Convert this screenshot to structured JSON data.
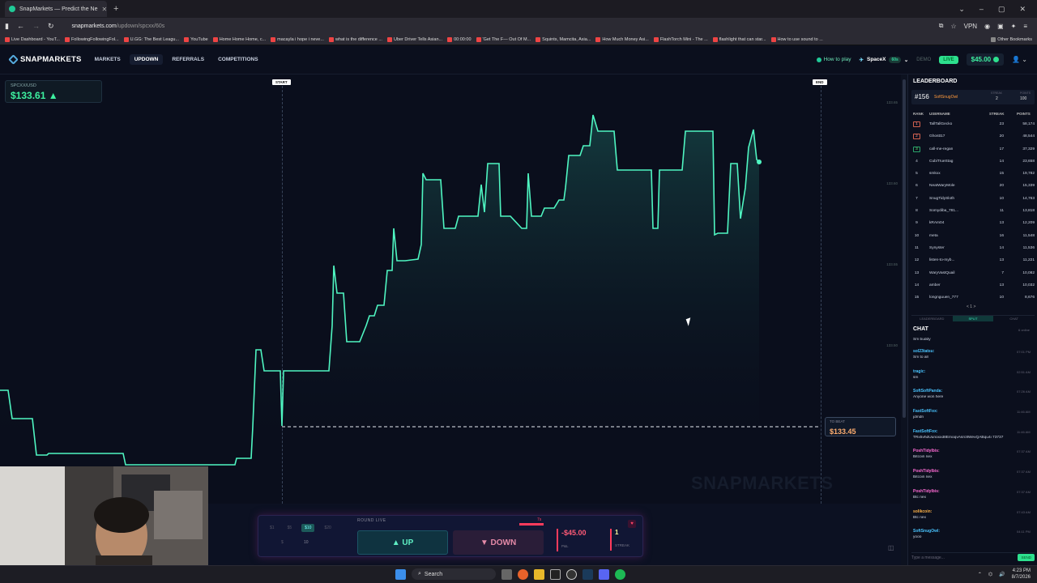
{
  "browser": {
    "tab_title": "SnapMarkets — Predict the Ne",
    "url_host": "snapmarkets.com",
    "url_path": "/updown/spcxx/60s",
    "vpn": "VPN",
    "window_controls": [
      "–",
      "▢",
      "✕"
    ],
    "new_tab": "+"
  },
  "bookmarks": [
    "Live Dashboard - YouT...",
    "FollowingFollowingFol...",
    "U.GG: The Best Leagu...",
    "YouTube",
    "Home Home Home, c...",
    "macayla i hope i neve...",
    "what is the difference ...",
    "Uber Driver Tells Asian...",
    "00:00:00",
    "'Get The F— Out Of M...",
    "Squints, Mamcita, Asia...",
    "How Much Money Asi...",
    "FlashTorch Mini - The ...",
    "flashlight that can star...",
    "How to use sound to ...",
    "Other Bookmarks"
  ],
  "header": {
    "logo": "SNAPMARKETS",
    "nav": [
      "MARKETS",
      "UPDOWN",
      "REFERRALS",
      "COMPETITIONS"
    ],
    "how_to_play": "How to play",
    "market": "SpaceX",
    "market_pill": "60s",
    "demo": "DEMO",
    "live": "LIVE",
    "balance": "$45.00"
  },
  "chart": {
    "pair": "SPCXX/USD",
    "price": "$133.61 ▲",
    "start_label": "START",
    "end_label": "END",
    "axis": [
      "133.65",
      "133.60",
      "133.55",
      "133.50"
    ],
    "to_beat_label": "TO BEAT",
    "to_beat_value": "$133.45",
    "watermark": "SNAPMARKETS",
    "line_color": "#4ff5c1"
  },
  "controls": {
    "amounts": [
      "$1",
      "$5",
      "$10",
      "$20"
    ],
    "qty_label": "$",
    "qty_value": "10",
    "round_status": "ROUND LIVE",
    "countdown": "7s",
    "up": "▲ UP",
    "down": "▼ DOWN",
    "pnl_value": "-$45.00",
    "pnl_label": "P&L",
    "streak_value": "1",
    "streak_label": "STREAK"
  },
  "leaderboard": {
    "title": "LEADERBOARD",
    "my_rank": "#156",
    "my_name": "SoftSnugOwl",
    "my_streak_label": "STREAK",
    "my_streak": "2",
    "my_points_label": "POINTS",
    "my_points": "100",
    "columns": [
      "RANK",
      "USERNAME",
      "STREAK",
      "POINTS"
    ],
    "rows": [
      [
        "1",
        "TallTallGecko",
        "23",
        "58,174"
      ],
      [
        "2",
        "Ghostt17",
        "20",
        "48,544"
      ],
      [
        "3",
        "call-me-regan",
        "17",
        "37,329"
      ],
      [
        "4",
        "CubiTrueStag",
        "14",
        "23,658"
      ],
      [
        "5",
        "smkxx",
        "15",
        "19,782"
      ],
      [
        "6",
        "NeatWaryMole",
        "20",
        "15,339"
      ],
      [
        "7",
        "SnugTidySloth",
        "10",
        "14,763"
      ],
      [
        "8",
        "Somydiba_781...",
        "11",
        "13,818"
      ],
      [
        "9",
        "kRAm04",
        "13",
        "12,209"
      ],
      [
        "10",
        "meta",
        "16",
        "11,548"
      ],
      [
        "11",
        "Synyster",
        "14",
        "11,536"
      ],
      [
        "12",
        "listen-to-myb...",
        "13",
        "11,221"
      ],
      [
        "13",
        "WaryVastQuail",
        "7",
        "10,082"
      ],
      [
        "14",
        "amber",
        "13",
        "10,032"
      ],
      [
        "15",
        "longnguuen_777",
        "10",
        "8,676"
      ]
    ],
    "pager": "< 1 >",
    "tabs": [
      "LEADERBOARD",
      "SPLIT",
      "CHAT"
    ]
  },
  "chat": {
    "title": "CHAT",
    "online": "6 online",
    "messages": [
      {
        "user": "",
        "time": "",
        "text": "Sm buddy"
      },
      {
        "user": "sol23tatsu:",
        "time": "07:01 PM",
        "text": "Sm to all"
      },
      {
        "user": "tragic:",
        "time": "02:51 AM",
        "text": "sm"
      },
      {
        "user": "SoftSoftPanda:",
        "time": "07:26 AM",
        "text": "Anyone won here"
      },
      {
        "user": "FastSoftFox:",
        "time": "11:46 AM",
        "text": "jdmdn"
      },
      {
        "user": "FastSoftFox:",
        "time": "11:46 AM",
        "text": "TRx5vhdUunoxxd8EmoqvAsrc8WevQABqu4i 73737"
      },
      {
        "user": "PoshTidyIbis:",
        "time": "07:37 AM",
        "text": "Bitcoin nex"
      },
      {
        "user": "PoshTidyIbis:",
        "time": "07:37 AM",
        "text": "Bitcoin nex"
      },
      {
        "user": "PoshTidyIbis:",
        "time": "07:37 AM",
        "text": "Btc nex"
      },
      {
        "user": "solikcoin:",
        "time": "07:43 AM",
        "text": "Btc nex"
      },
      {
        "user": "SoftSnugOwl:",
        "time": "04:11 PM",
        "text": "yooo"
      }
    ],
    "placeholder": "Type a message...",
    "send": "SEND"
  },
  "taskbar": {
    "search": "Search",
    "time": "4:23 PM",
    "date": "8/7/2026"
  }
}
